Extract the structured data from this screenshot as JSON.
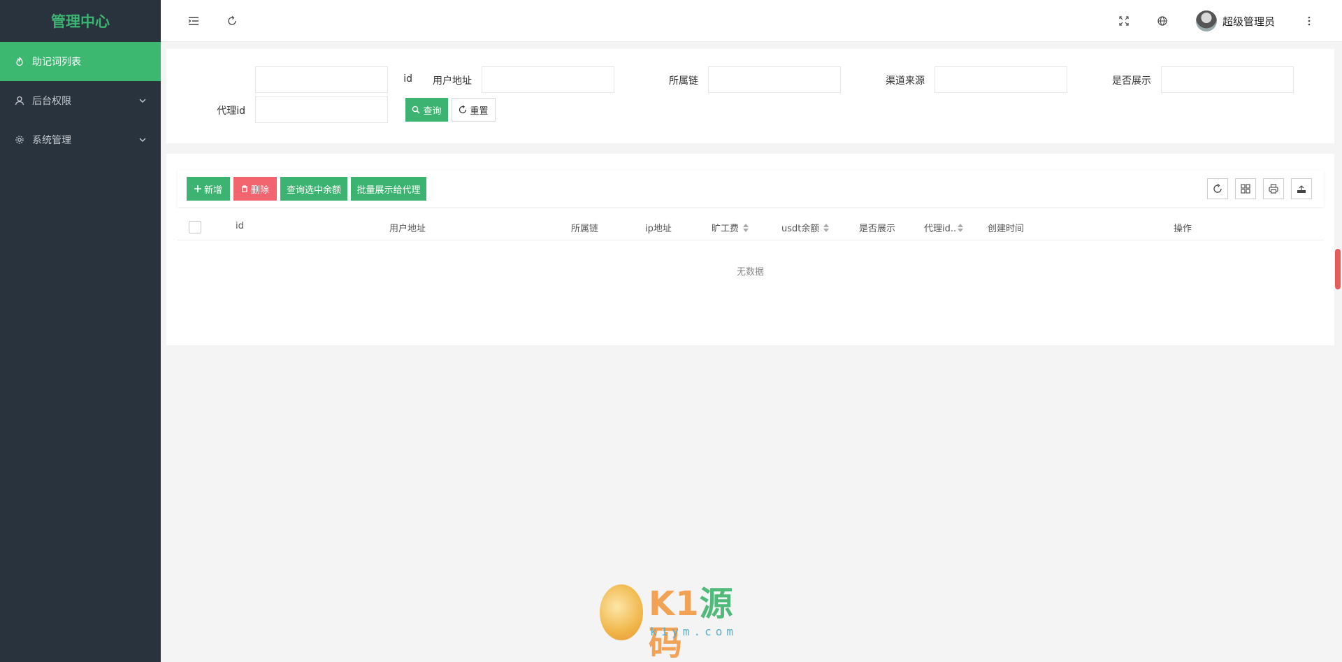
{
  "sidebar": {
    "brand": "管理中心",
    "items": [
      {
        "label": "助记词列表"
      },
      {
        "label": "后台权限"
      },
      {
        "label": "系统管理"
      }
    ]
  },
  "header": {
    "user_name": "超级管理员"
  },
  "search": {
    "fields": [
      {
        "label": "id",
        "value": ""
      },
      {
        "label": "用户地址",
        "value": ""
      },
      {
        "label": "所属链",
        "value": ""
      },
      {
        "label": "渠道来源",
        "value": ""
      },
      {
        "label": "是否展示",
        "value": ""
      },
      {
        "label": "代理id",
        "value": ""
      }
    ],
    "query_label": "查询",
    "reset_label": "重置"
  },
  "toolbar": {
    "add_label": "新增",
    "delete_label": "删除",
    "query_balance_label": "查询选中余额",
    "batch_show_label": "批量展示给代理"
  },
  "table": {
    "columns": [
      "id",
      "用户地址",
      "所属链",
      "ip地址",
      "旷工费",
      "usdt余额",
      "是否展示",
      "代理id..",
      "创建时间",
      "操作"
    ],
    "empty_text": "无数据"
  },
  "watermark": {
    "text_a": "K1",
    "text_b": "源",
    "text_c": "码",
    "sub": "k1ym.com"
  },
  "colors": {
    "accent": "#3cb371",
    "danger": "#f2656f",
    "sidebar_bg": "#28333e"
  }
}
